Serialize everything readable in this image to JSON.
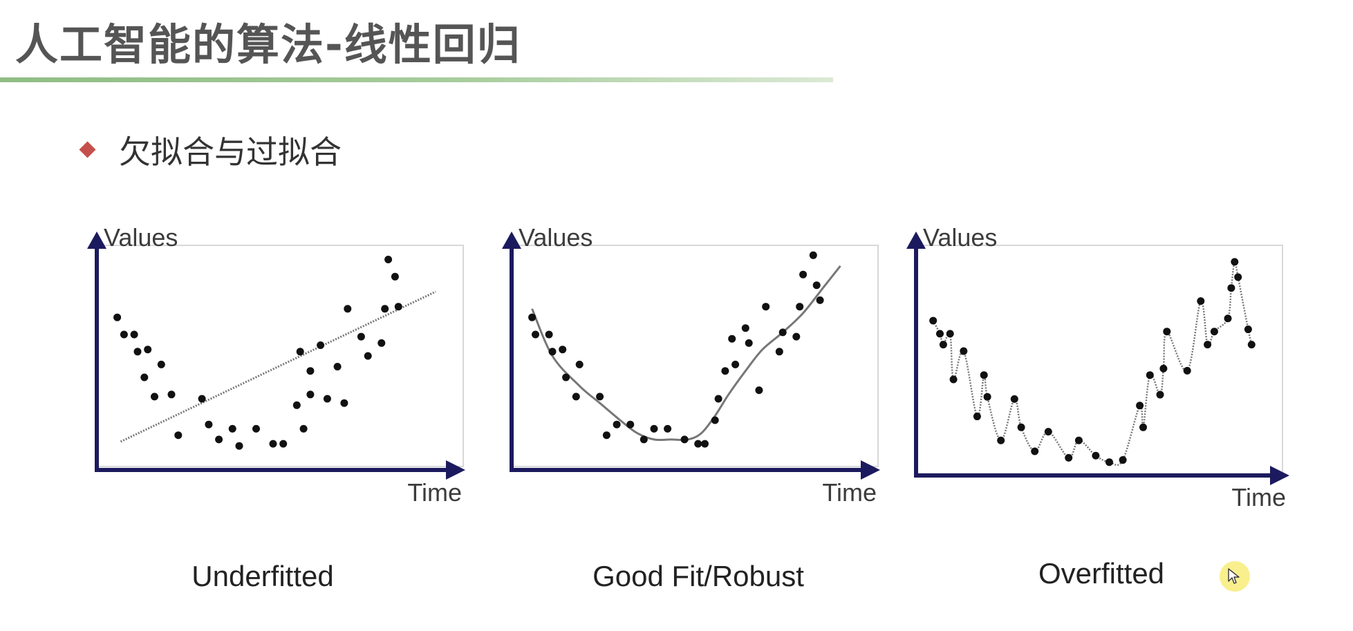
{
  "slide": {
    "title": "人工智能的算法-线性回归",
    "bullet": "欠拟合与过拟合"
  },
  "colors": {
    "title_rule": "#8fbd84",
    "bullet": "#c5504b",
    "axis": "#1c1a5e",
    "points": "#111111",
    "curve": "#777777",
    "cursor_highlight": "#f8ec78"
  },
  "cursor": {
    "icon": "mouse-pointer-icon"
  },
  "chart_data": [
    {
      "type": "scatter",
      "title": "Underfitted",
      "xlabel": "Time",
      "ylabel": "Values",
      "fit": "straight-line",
      "xlim": [
        0,
        100
      ],
      "ylim": [
        0,
        100
      ],
      "points": [
        [
          4,
          68
        ],
        [
          6,
          60
        ],
        [
          9,
          60
        ],
        [
          10,
          52
        ],
        [
          13,
          53
        ],
        [
          12,
          40
        ],
        [
          17,
          46
        ],
        [
          15,
          31
        ],
        [
          20,
          32
        ],
        [
          22,
          13
        ],
        [
          29,
          30
        ],
        [
          31,
          18
        ],
        [
          34,
          11
        ],
        [
          38,
          16
        ],
        [
          40,
          8
        ],
        [
          45,
          16
        ],
        [
          50,
          9
        ],
        [
          53,
          9
        ],
        [
          57,
          27
        ],
        [
          59,
          16
        ],
        [
          58,
          52
        ],
        [
          61,
          43
        ],
        [
          64,
          55
        ],
        [
          61,
          32
        ],
        [
          66,
          30
        ],
        [
          69,
          45
        ],
        [
          71,
          28
        ],
        [
          72,
          72
        ],
        [
          76,
          59
        ],
        [
          78,
          50
        ],
        [
          82,
          56
        ],
        [
          83,
          72
        ],
        [
          84,
          95
        ],
        [
          86,
          87
        ],
        [
          87,
          73
        ]
      ],
      "fit_line": [
        [
          5,
          10
        ],
        [
          98,
          80
        ]
      ]
    },
    {
      "type": "scatter",
      "title": "Good Fit/Robust",
      "xlabel": "Time",
      "ylabel": "Values",
      "fit": "smooth-curve",
      "xlim": [
        0,
        100
      ],
      "ylim": [
        0,
        100
      ],
      "points": [
        [
          4,
          68
        ],
        [
          5,
          60
        ],
        [
          9,
          60
        ],
        [
          10,
          52
        ],
        [
          13,
          53
        ],
        [
          14,
          40
        ],
        [
          18,
          46
        ],
        [
          17,
          31
        ],
        [
          24,
          31
        ],
        [
          26,
          13
        ],
        [
          29,
          18
        ],
        [
          33,
          18
        ],
        [
          37,
          11
        ],
        [
          40,
          16
        ],
        [
          44,
          16
        ],
        [
          49,
          11
        ],
        [
          53,
          9
        ],
        [
          55,
          9
        ],
        [
          58,
          20
        ],
        [
          59,
          30
        ],
        [
          61,
          43
        ],
        [
          63,
          58
        ],
        [
          64,
          46
        ],
        [
          67,
          63
        ],
        [
          68,
          56
        ],
        [
          71,
          34
        ],
        [
          73,
          73
        ],
        [
          78,
          61
        ],
        [
          77,
          52
        ],
        [
          82,
          59
        ],
        [
          83,
          73
        ],
        [
          84,
          88
        ],
        [
          87,
          97
        ],
        [
          88,
          83
        ],
        [
          89,
          76
        ]
      ],
      "fit_curve": [
        [
          4,
          72
        ],
        [
          10,
          50
        ],
        [
          18,
          36
        ],
        [
          24,
          28
        ],
        [
          30,
          20
        ],
        [
          35,
          14
        ],
        [
          40,
          11
        ],
        [
          45,
          11
        ],
        [
          50,
          11
        ],
        [
          54,
          14
        ],
        [
          58,
          22
        ],
        [
          62,
          32
        ],
        [
          67,
          43
        ],
        [
          72,
          53
        ],
        [
          78,
          61
        ],
        [
          84,
          70
        ],
        [
          90,
          82
        ],
        [
          95,
          92
        ]
      ]
    },
    {
      "type": "scatter",
      "title": "Overfitted",
      "xlabel": "Time",
      "ylabel": "Values",
      "fit": "wiggly-curve",
      "xlim": [
        0,
        100
      ],
      "ylim": [
        0,
        100
      ],
      "points": [
        [
          3,
          67
        ],
        [
          5,
          61
        ],
        [
          6,
          56
        ],
        [
          8,
          61
        ],
        [
          9,
          40
        ],
        [
          12,
          53
        ],
        [
          16,
          23
        ],
        [
          18,
          42
        ],
        [
          19,
          32
        ],
        [
          23,
          12
        ],
        [
          27,
          31
        ],
        [
          29,
          18
        ],
        [
          33,
          7
        ],
        [
          37,
          16
        ],
        [
          43,
          4
        ],
        [
          46,
          12
        ],
        [
          51,
          5
        ],
        [
          55,
          2
        ],
        [
          59,
          3
        ],
        [
          64,
          28
        ],
        [
          65,
          18
        ],
        [
          67,
          42
        ],
        [
          70,
          33
        ],
        [
          71,
          45
        ],
        [
          72,
          62
        ],
        [
          78,
          44
        ],
        [
          82,
          76
        ],
        [
          84,
          56
        ],
        [
          86,
          62
        ],
        [
          90,
          68
        ],
        [
          91,
          82
        ],
        [
          92,
          94
        ],
        [
          93,
          87
        ],
        [
          96,
          63
        ],
        [
          97,
          56
        ]
      ]
    }
  ],
  "captions": [
    "Underfitted",
    "Good Fit/Robust",
    "Overfitted"
  ]
}
